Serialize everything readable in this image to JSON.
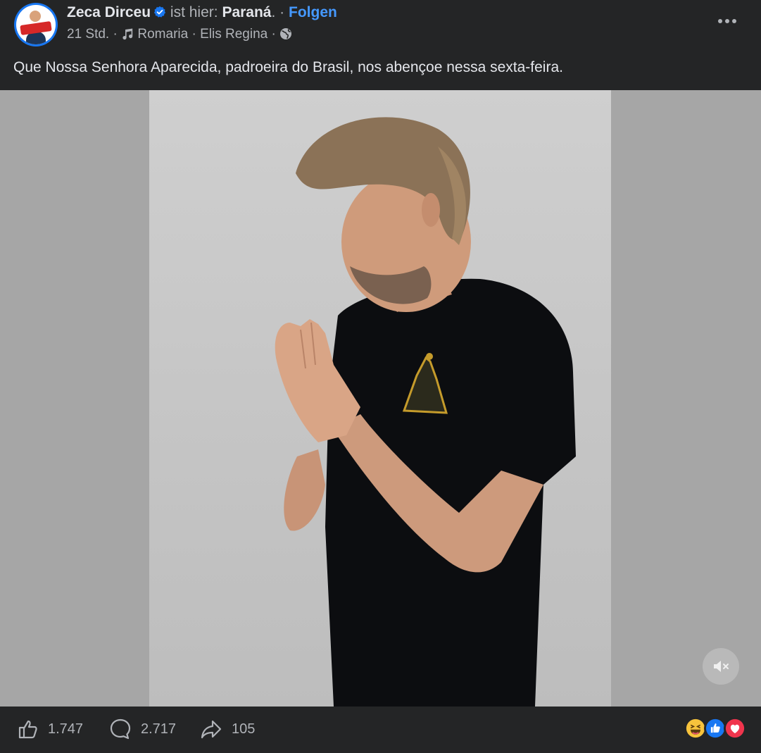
{
  "post": {
    "author": "Zeca Dirceu",
    "location_prefix": "ist hier:",
    "location": "Paraná",
    "location_suffix": ".",
    "separator": "·",
    "follow_label": "Folgen",
    "time": "21 Std.",
    "song": "Romaria",
    "artist": "Elis Regina",
    "caption": "Que Nossa Senhora Aparecida, padroeira do Brasil, nos abençoe nessa sexta-feira.",
    "audience_icon": "globe-icon",
    "verified_icon": "verified-badge-icon",
    "music_icon": "music-note-icon"
  },
  "media": {
    "mute_icon": "speaker-muted-icon"
  },
  "stats": {
    "likes": "1.747",
    "comments": "2.717",
    "shares": "105"
  },
  "reactions": [
    "haha",
    "like",
    "love"
  ],
  "colors": {
    "background": "#242526",
    "text": "#e4e6eb",
    "muted": "#b0b3b8",
    "accent": "#4599ff",
    "verified": "#1877f2"
  }
}
